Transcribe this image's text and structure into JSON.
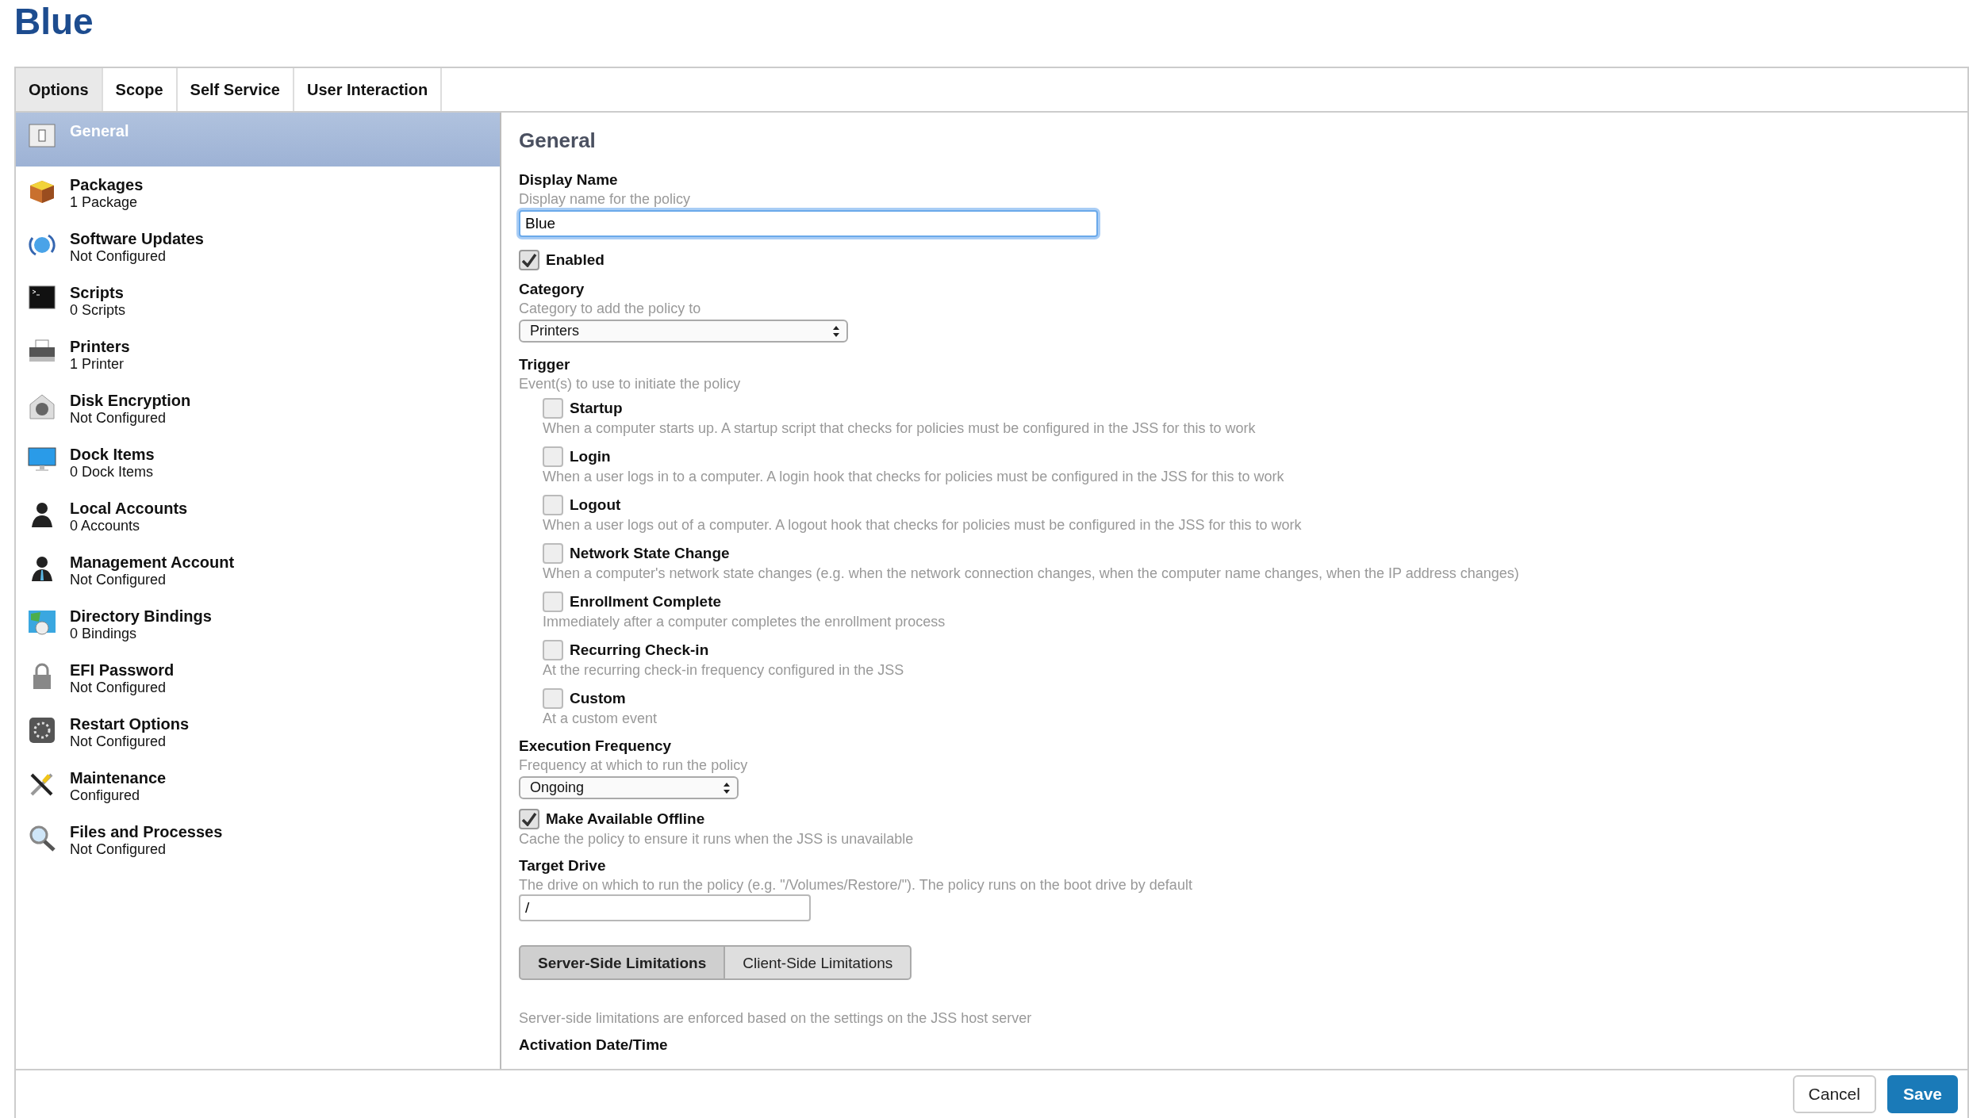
{
  "title": "Blue",
  "tabs": [
    {
      "label": "Options",
      "selected": true
    },
    {
      "label": "Scope",
      "selected": false
    },
    {
      "label": "Self Service",
      "selected": false
    },
    {
      "label": "User Interaction",
      "selected": false
    }
  ],
  "sidebar": {
    "items": [
      {
        "name": "General",
        "selected": true
      },
      {
        "name": "Packages",
        "status": "1 Package",
        "selected": false
      },
      {
        "name": "Software Updates",
        "status": "Not Configured",
        "selected": false
      },
      {
        "name": "Scripts",
        "status": "0 Scripts",
        "selected": false
      },
      {
        "name": "Printers",
        "status": "1 Printer",
        "selected": false
      },
      {
        "name": "Disk Encryption",
        "status": "Not Configured",
        "selected": false
      },
      {
        "name": "Dock Items",
        "status": "0 Dock Items",
        "selected": false
      },
      {
        "name": "Local Accounts",
        "status": "0 Accounts",
        "selected": false
      },
      {
        "name": "Management Account",
        "status": "Not Configured",
        "selected": false
      },
      {
        "name": "Directory Bindings",
        "status": "0 Bindings",
        "selected": false
      },
      {
        "name": "EFI Password",
        "status": "Not Configured",
        "selected": false
      },
      {
        "name": "Restart Options",
        "status": "Not Configured",
        "selected": false
      },
      {
        "name": "Maintenance",
        "status": "Configured",
        "selected": false
      },
      {
        "name": "Files and Processes",
        "status": "Not Configured",
        "selected": false
      }
    ]
  },
  "general": {
    "heading": "General",
    "display_name": {
      "label": "Display Name",
      "hint": "Display name for the policy",
      "value": "Blue"
    },
    "enabled": {
      "label": "Enabled",
      "checked": true
    },
    "category": {
      "label": "Category",
      "hint": "Category to add the policy to",
      "value": "Printers"
    },
    "trigger": {
      "label": "Trigger",
      "hint": "Event(s) to use to initiate the policy",
      "options": [
        {
          "label": "Startup",
          "description": "When a computer starts up. A startup script that checks for policies must be configured in the JSS for this to work",
          "checked": false
        },
        {
          "label": "Login",
          "description": "When a user logs in to a computer. A login hook that checks for policies must be configured in the JSS for this to work",
          "checked": false
        },
        {
          "label": "Logout",
          "description": "When a user logs out of a computer. A logout hook that checks for policies must be configured in the JSS for this to work",
          "checked": false
        },
        {
          "label": "Network State Change",
          "description": "When a computer's network state changes (e.g. when the network connection changes, when the computer name changes, when the IP address changes)",
          "checked": false
        },
        {
          "label": "Enrollment Complete",
          "description": "Immediately after a computer completes the enrollment process",
          "checked": false
        },
        {
          "label": "Recurring Check-in",
          "description": "At the recurring check-in frequency configured in the JSS",
          "checked": false
        },
        {
          "label": "Custom",
          "description": "At a custom event",
          "checked": false
        }
      ]
    },
    "execution_frequency": {
      "label": "Execution Frequency",
      "hint": "Frequency at which to run the policy",
      "value": "Ongoing"
    },
    "make_available_offline": {
      "label": "Make Available Offline",
      "description": "Cache the policy to ensure it runs when the JSS is unavailable",
      "checked": true
    },
    "target_drive": {
      "label": "Target Drive",
      "hint": "The drive on which to run the policy (e.g. \"/Volumes/Restore/\"). The policy runs on the boot drive by default",
      "value": "/"
    },
    "limitation_tabs": [
      {
        "label": "Server-Side Limitations",
        "selected": true
      },
      {
        "label": "Client-Side Limitations",
        "selected": false
      }
    ],
    "limitations_note": "Server-side limitations are enforced based on the settings on the JSS host server",
    "activation": {
      "label": "Activation Date/Time"
    }
  },
  "footer": {
    "buttons": [
      {
        "label": "Cancel",
        "kind": "secondary"
      },
      {
        "label": "Save",
        "kind": "primary"
      }
    ]
  }
}
